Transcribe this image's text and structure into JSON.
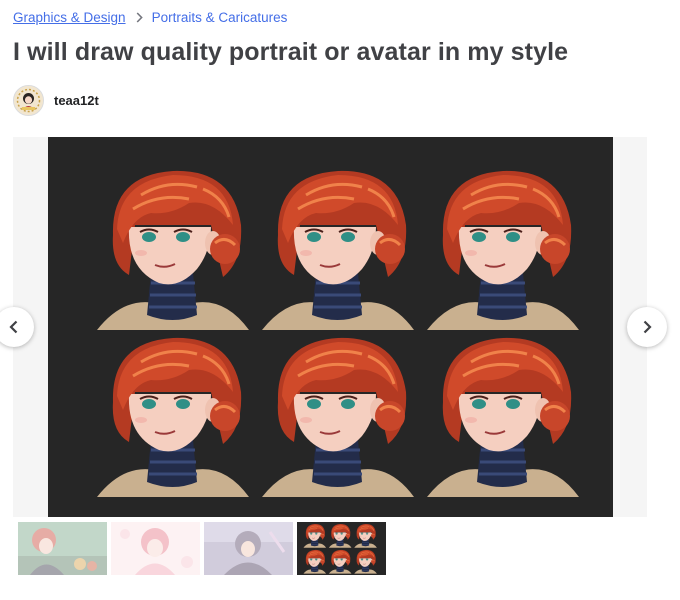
{
  "breadcrumb": {
    "category": "Graphics & Design",
    "subcategory": "Portraits & Caricatures",
    "separator_icon": "chevron-right-icon"
  },
  "gig": {
    "title": "I will draw quality portrait or avatar in my style"
  },
  "seller": {
    "username": "teaa12t",
    "avatar_icon": "seller-avatar"
  },
  "gallery": {
    "prev_icon": "chevron-left-icon",
    "next_icon": "chevron-right-icon",
    "active_thumbnail": 4,
    "thumbnails": [
      "thumbnail-1",
      "thumbnail-2",
      "thumbnail-3",
      "thumbnail-4"
    ],
    "image": {
      "background": "#262626",
      "hair": "#d04a2a",
      "hair_highlight": "#f0824a",
      "skin": "#f5cfc0",
      "eyes": "#2f8f86",
      "turtleneck": "#232c4a",
      "coat": "#c9b08f"
    }
  }
}
